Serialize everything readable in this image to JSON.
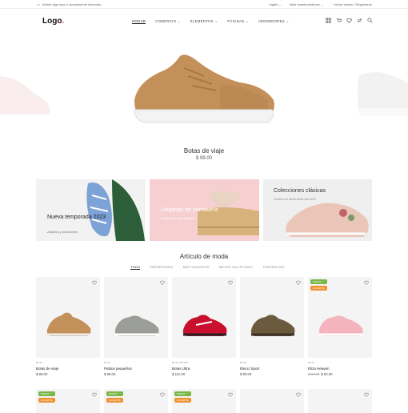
{
  "topbar": {
    "promo": "Añade algo aquí o simplemente elimínalo...",
    "language": "Inglés",
    "currency": "dólar estadounidense",
    "login": "Iniciar sesión / Registrarse"
  },
  "nav": {
    "logo": "Logo",
    "menu": [
      "HOGAR",
      "COMERCIO",
      "ELEMENTOS",
      "PÁGINAS",
      "VENDEDORES"
    ]
  },
  "hero": {
    "title": "Botas de viaje",
    "price": "$ 99.00"
  },
  "banners": [
    {
      "title": "Nueva temporada 2023",
      "subtitle": "Zapatos y accesorios"
    },
    {
      "title": "Llegadas de primavera",
      "subtitle": "Colecciones de zapatos"
    },
    {
      "title": "Colecciones clásicas",
      "subtitle": "Venta con descuento del 20%"
    }
  ],
  "section": {
    "title": "Artículo de moda",
    "tabs": [
      "TODO",
      "PRESENTADO",
      "MÁS VENDIDOS",
      "MEJOR CALIFICADO",
      "TENDENCIAS"
    ]
  },
  "products": [
    {
      "category": "BOTA",
      "name": "Botas de viaje",
      "price": "$ 99.00",
      "old_price": ""
    },
    {
      "category": "BOTA",
      "name": "Patitos pequeños",
      "price": "$ 95.00",
      "old_price": ""
    },
    {
      "category": "BOTA / BOTAS",
      "name": "Botas Ultra",
      "price": "$ 111.00",
      "old_price": ""
    },
    {
      "category": "BOTA",
      "name": "Eleccí Sport",
      "price": "$ 90.00",
      "old_price": ""
    },
    {
      "category": "BOTA",
      "name": "Eliza Heaven",
      "price": "$ 82.00",
      "old_price": "$ 90.00",
      "badges": [
        "NUEVO",
        "CALIENTE"
      ]
    }
  ],
  "row2_badges": [
    "NUEVO",
    "CALIENTE"
  ]
}
